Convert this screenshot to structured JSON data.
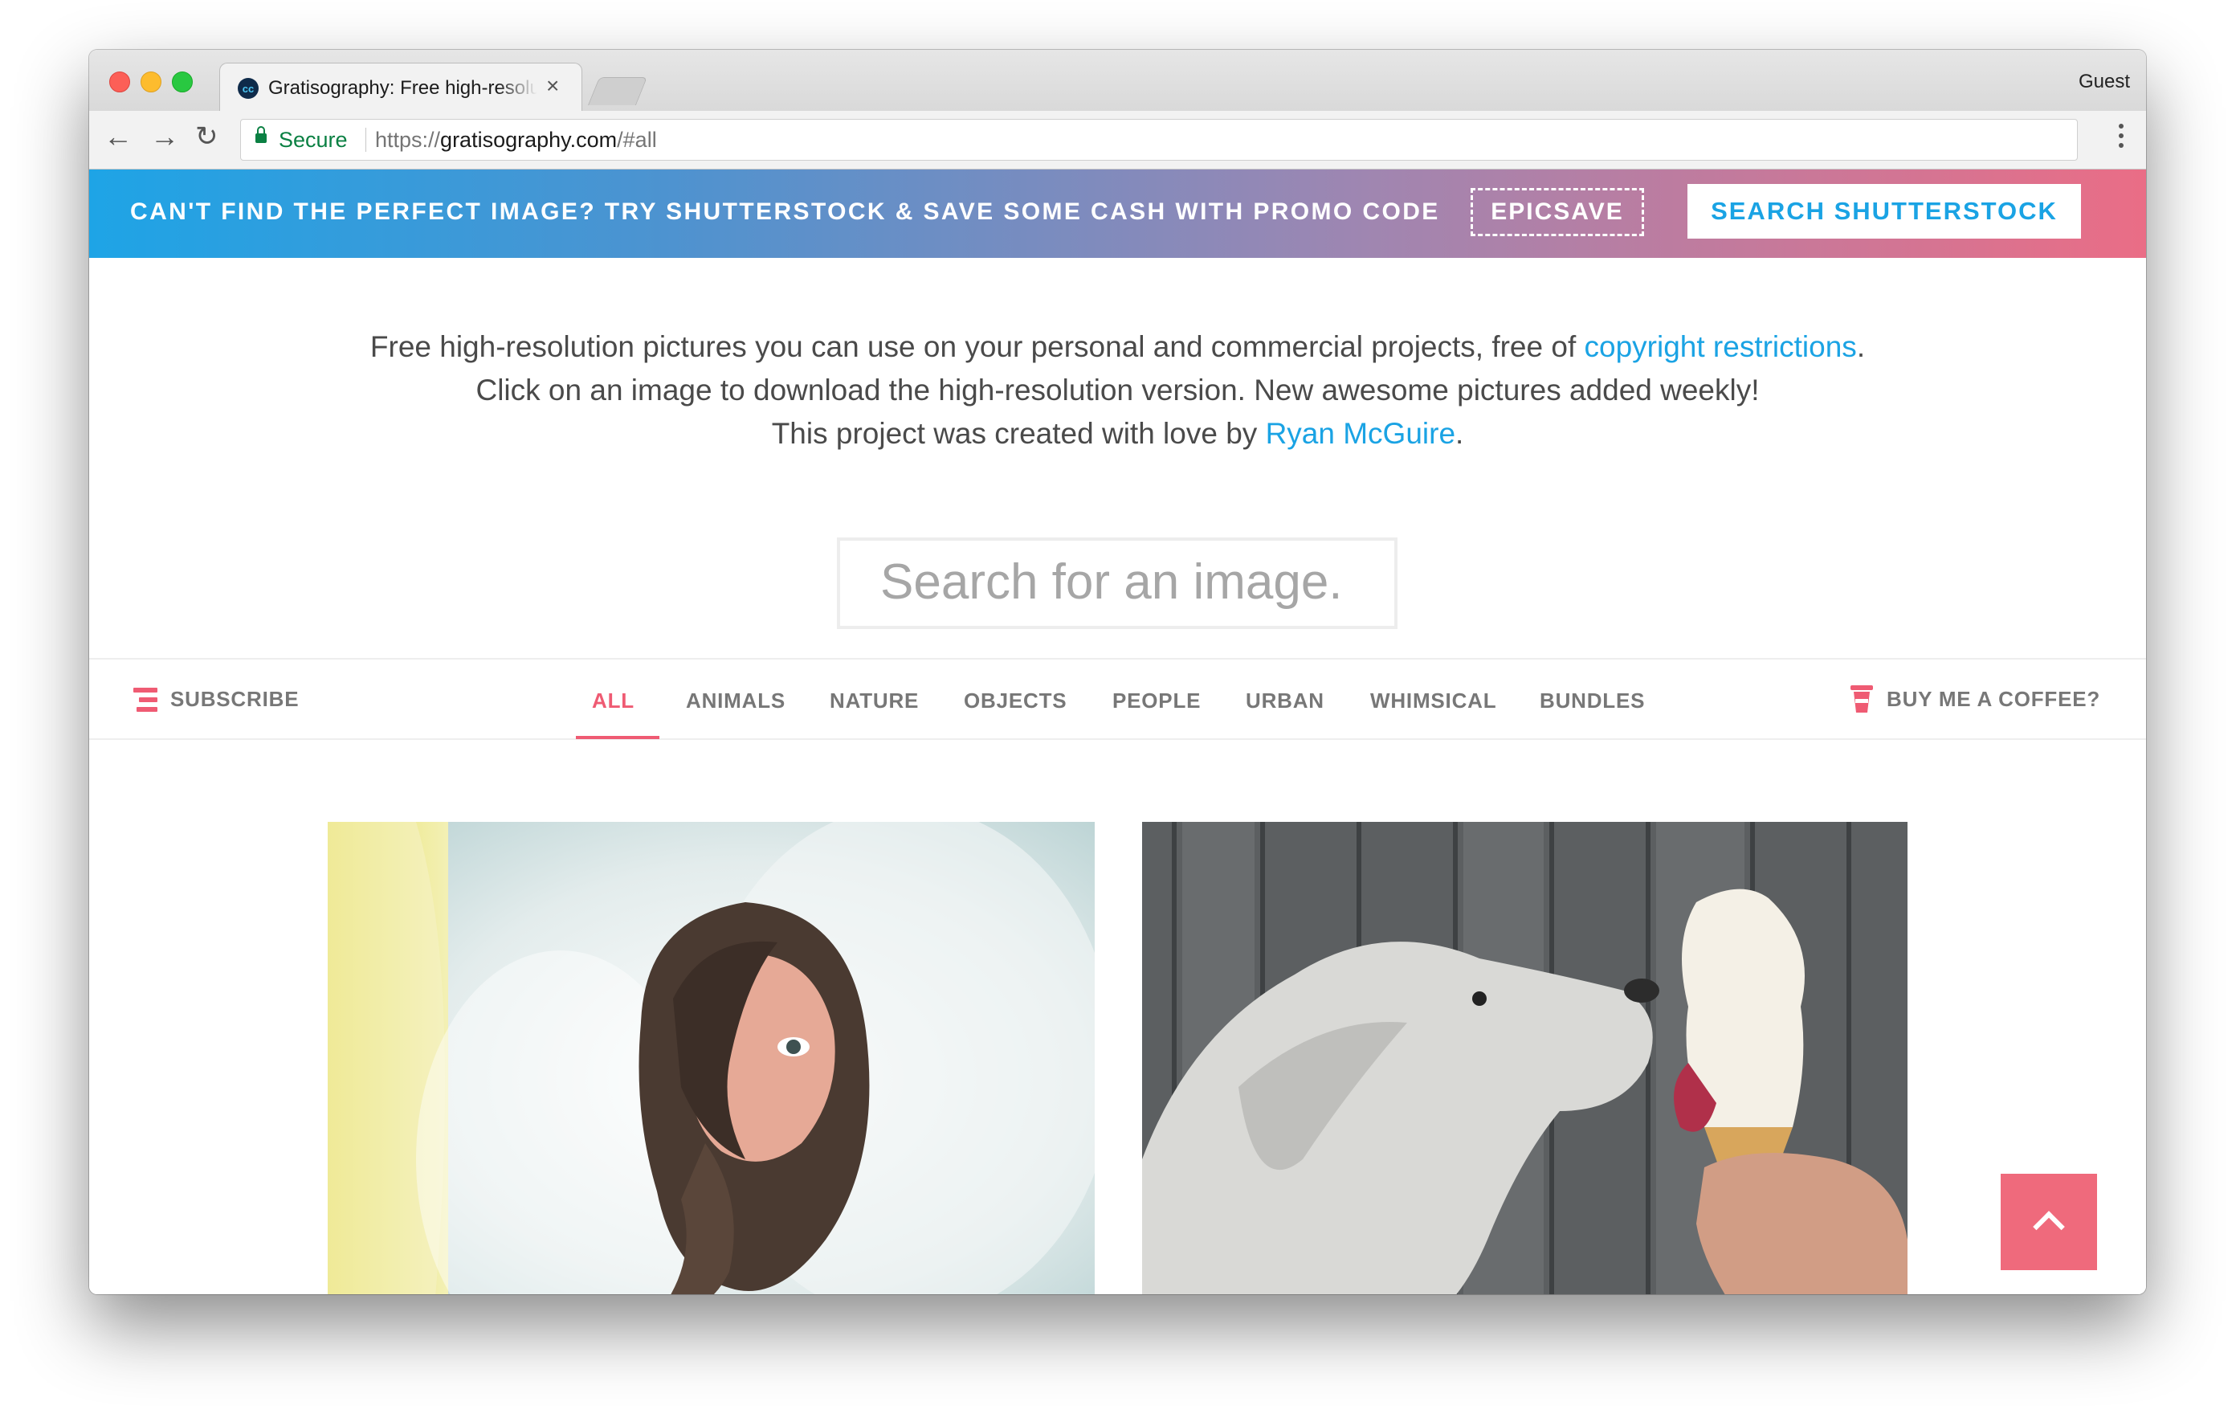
{
  "browser": {
    "tab": {
      "favicon_text": "cc",
      "title": "Gratisography: Free high-resolution pictures",
      "close": "×"
    },
    "profile": "Guest",
    "nav": {
      "back": "←",
      "forward": "→",
      "reload": "↻"
    },
    "omnibox": {
      "secure_label": "Secure",
      "url_scheme": "https://",
      "url_host": "gratisography.com",
      "url_fragment": "/#all"
    }
  },
  "promo": {
    "text": "CAN'T FIND THE PERFECT IMAGE? TRY SHUTTERSTOCK & SAVE SOME CASH WITH PROMO CODE",
    "code": "EPICSAVE",
    "button": "SEARCH SHUTTERSTOCK"
  },
  "intro": {
    "line1_prefix": "Free high-resolution pictures you can use on your personal and commercial projects, free of ",
    "line1_link": "copyright restrictions",
    "line1_suffix": ".",
    "line2": "Click on an image to download the high-resolution version. New awesome pictures added weekly!",
    "line3_prefix": "This project was created with love by ",
    "line3_link": "Ryan McGuire",
    "line3_suffix": "."
  },
  "search": {
    "placeholder": "Search for an image."
  },
  "filters": {
    "subscribe": "SUBSCRIBE",
    "categories": [
      "ALL",
      "ANIMALS",
      "NATURE",
      "OBJECTS",
      "PEOPLE",
      "URBAN",
      "WHIMSICAL",
      "BUNDLES"
    ],
    "active_category": "ALL",
    "coffee": "BUY ME A COFFEE?"
  },
  "gallery": {
    "photos": [
      {
        "subject": "woman-in-bubble-wrap"
      },
      {
        "subject": "dog-licking-ice-cream"
      }
    ]
  },
  "colors": {
    "accent": "#ef5b73",
    "link": "#1aa3e4",
    "secure": "#0b8043"
  }
}
